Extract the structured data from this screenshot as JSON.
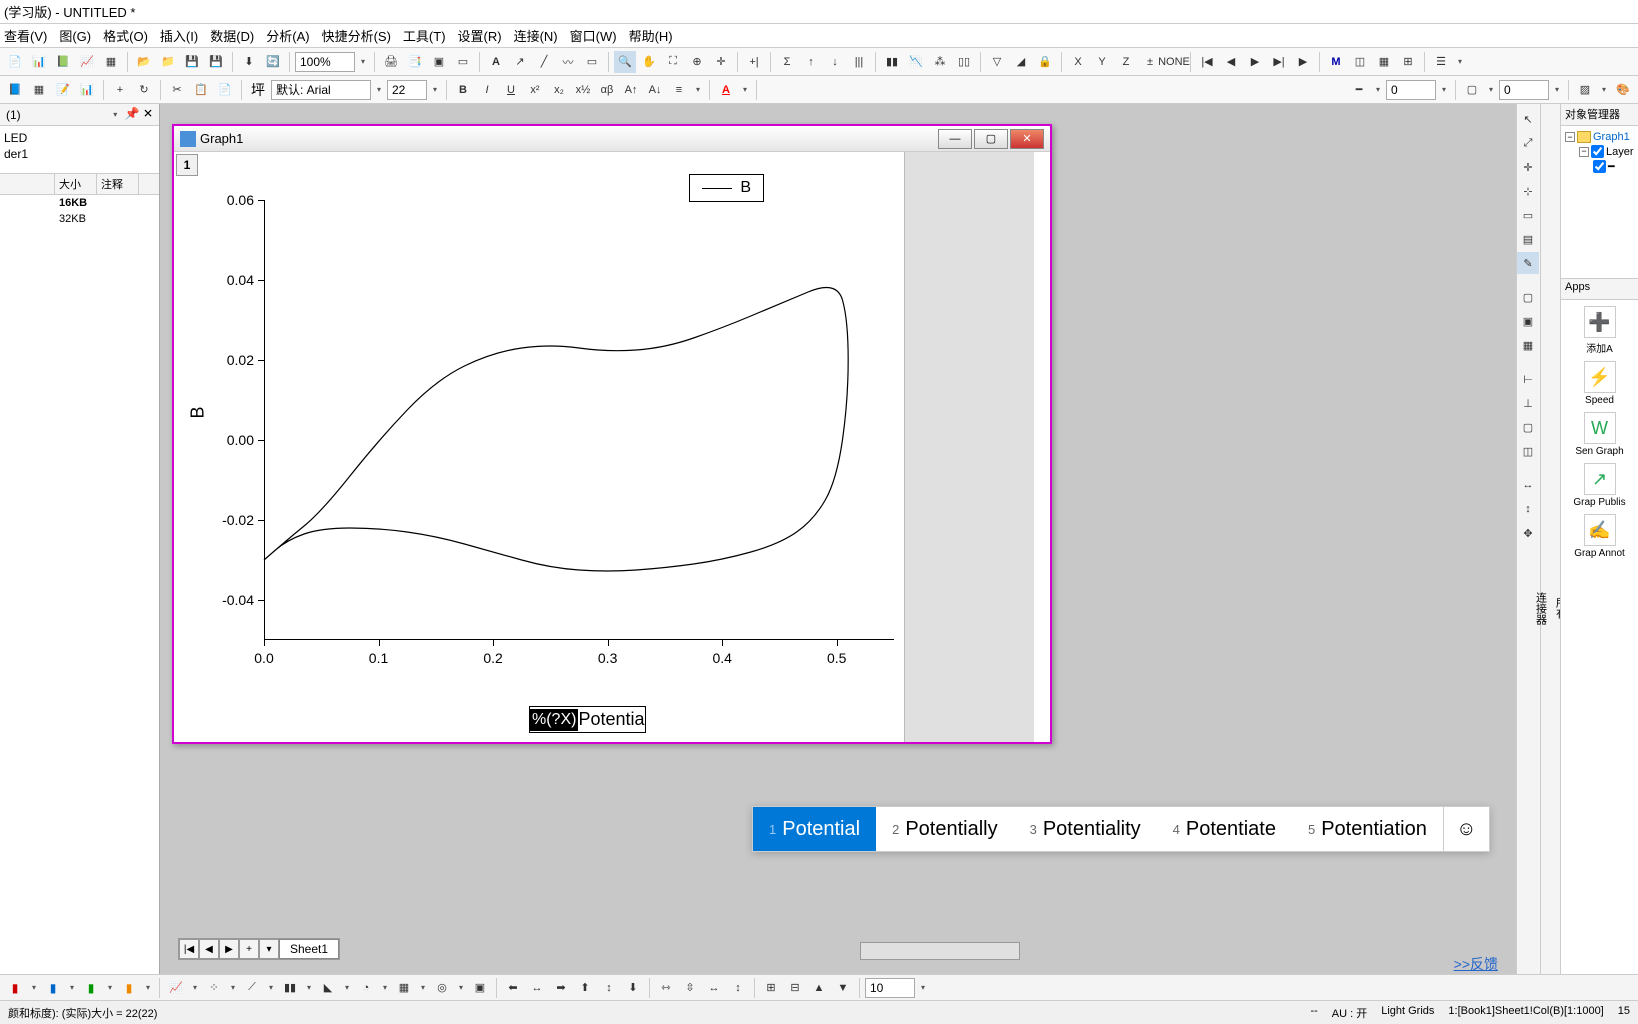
{
  "titlebar": "(学习版) - UNTITLED *",
  "menus": [
    "查看(V)",
    "图(G)",
    "格式(O)",
    "插入(I)",
    "数据(D)",
    "分析(A)",
    "快捷分析(S)",
    "工具(T)",
    "设置(R)",
    "连接(N)",
    "窗口(W)",
    "帮助(H)"
  ],
  "toolbar1": {
    "zoom": "100%",
    "font_label": "默认: Arial",
    "font_size": "22"
  },
  "format_input1": "0",
  "format_input2": "0",
  "left_panel": {
    "header": "(1)",
    "tree": [
      "LED",
      "der1"
    ],
    "cols": [
      "",
      "大小",
      "注释"
    ],
    "rows": [
      {
        "name": "",
        "size": "16KB",
        "note": ""
      },
      {
        "name": "",
        "size": "32KB",
        "note": ""
      }
    ]
  },
  "right_panel": {
    "header1": "对象管理器",
    "tree": [
      {
        "label": "Graph1",
        "children": [
          {
            "label": "Layer"
          }
        ]
      }
    ],
    "header2": "Apps",
    "apps": [
      "添加A",
      "Speed",
      "Sen Graph",
      "Grap Publis",
      "Grap Annot"
    ]
  },
  "graph": {
    "title": "Graph1",
    "layer_tab": "1",
    "legend": "B",
    "ylabel": "B",
    "xlabel_sel": "%(?X)",
    "xlabel_rest": "Potentia"
  },
  "ime": {
    "items": [
      "Potential",
      "Potentially",
      "Potentiality",
      "Potentiate",
      "Potentiation"
    ]
  },
  "sheet": {
    "tab": "Sheet1"
  },
  "bottom_input": "10",
  "status": {
    "left": "颜和标度): (实际)大小 = 22(22)",
    "au": "AU : 开",
    "grids": "Light Grids",
    "ref": "1:[Book1]Sheet1!Col(B)[1:1000]",
    "extra": "15"
  },
  "feedback": ">>反馈",
  "chart_data": {
    "type": "line",
    "title": "",
    "xlabel": "Potentia",
    "ylabel": "B",
    "legend": [
      "B"
    ],
    "xlim": [
      0.0,
      0.55
    ],
    "ylim": [
      -0.05,
      0.06
    ],
    "xticks": [
      0.0,
      0.1,
      0.2,
      0.3,
      0.4,
      0.5
    ],
    "yticks": [
      -0.04,
      -0.02,
      0.0,
      0.02,
      0.04,
      0.06
    ],
    "series": [
      {
        "name": "B",
        "x": [
          0.0,
          0.02,
          0.05,
          0.1,
          0.15,
          0.2,
          0.25,
          0.3,
          0.35,
          0.4,
          0.45,
          0.5,
          0.51,
          0.51,
          0.5,
          0.48,
          0.45,
          0.4,
          0.35,
          0.3,
          0.25,
          0.2,
          0.15,
          0.1,
          0.05,
          0.02,
          0.0
        ],
        "y": [
          -0.03,
          -0.025,
          -0.018,
          0.0,
          0.015,
          0.022,
          0.024,
          0.022,
          0.023,
          0.028,
          0.034,
          0.04,
          0.03,
          0.01,
          -0.01,
          -0.02,
          -0.026,
          -0.03,
          -0.032,
          -0.033,
          -0.032,
          -0.028,
          -0.024,
          -0.022,
          -0.022,
          -0.025,
          -0.03
        ]
      }
    ]
  }
}
